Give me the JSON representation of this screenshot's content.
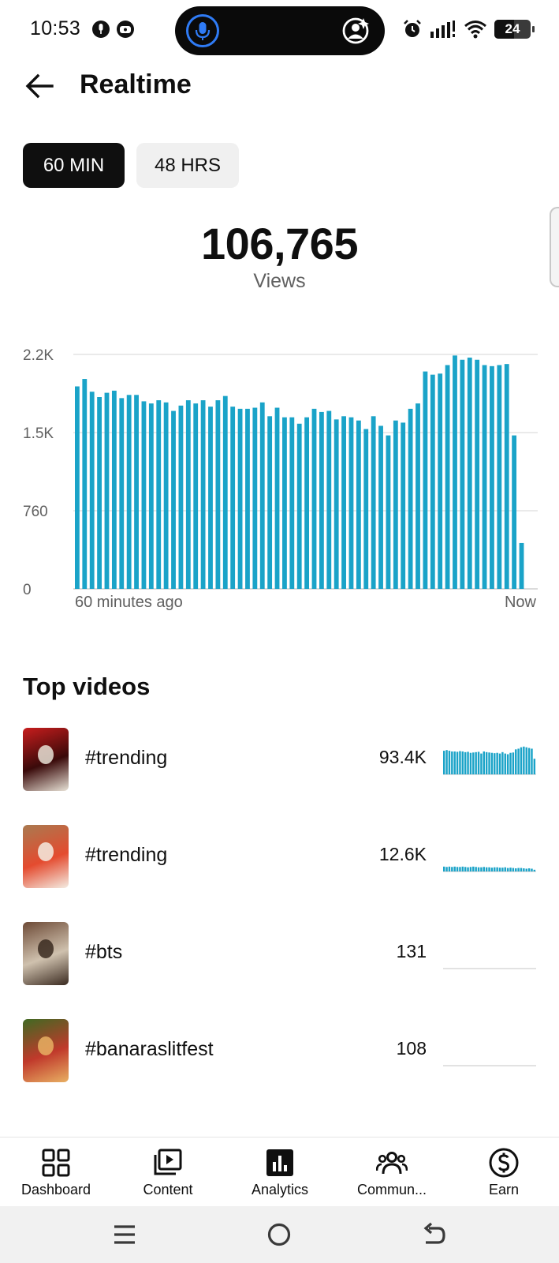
{
  "status_bar": {
    "time": "10:53",
    "battery": "24",
    "icons": [
      "mic-icon",
      "profile-icon",
      "alarm-icon",
      "signal-icon",
      "wifi-icon",
      "battery-icon"
    ]
  },
  "header": {
    "title": "Realtime",
    "back_icon": "back-arrow-icon"
  },
  "range_chips": [
    {
      "label": "60 MIN",
      "selected": true
    },
    {
      "label": "48 HRS",
      "selected": false
    }
  ],
  "summary": {
    "value": "106,765",
    "label": "Views"
  },
  "chart_data": {
    "type": "bar",
    "color": "#1aa3c8",
    "y_ticks": [
      "2.2K",
      "1.5K",
      "760",
      "0"
    ],
    "ylim": [
      0,
      2200
    ],
    "x_start_label": "60 minutes ago",
    "x_end_label": "Now",
    "values": [
      1900,
      1970,
      1850,
      1800,
      1840,
      1860,
      1790,
      1820,
      1820,
      1760,
      1740,
      1770,
      1750,
      1670,
      1720,
      1770,
      1740,
      1770,
      1710,
      1770,
      1810,
      1710,
      1690,
      1690,
      1700,
      1750,
      1620,
      1700,
      1610,
      1610,
      1550,
      1610,
      1690,
      1660,
      1670,
      1590,
      1620,
      1610,
      1580,
      1500,
      1620,
      1530,
      1440,
      1580,
      1560,
      1690,
      1740,
      2040,
      2010,
      2020,
      2100,
      2190,
      2150,
      2170,
      2150,
      2100,
      2090,
      2100,
      2110,
      1440,
      430
    ]
  },
  "top_videos": {
    "title": "Top videos",
    "items": [
      {
        "title": "#trending",
        "views": "93.4K",
        "thumb_colors": [
          "#c81d1d",
          "#3a0a0a",
          "#e8e2d6"
        ],
        "spark": [
          0.68,
          0.7,
          0.68,
          0.66,
          0.66,
          0.65,
          0.67,
          0.66,
          0.64,
          0.65,
          0.62,
          0.63,
          0.64,
          0.65,
          0.6,
          0.66,
          0.64,
          0.63,
          0.62,
          0.61,
          0.62,
          0.6,
          0.64,
          0.6,
          0.58,
          0.62,
          0.63,
          0.72,
          0.74,
          0.78,
          0.8,
          0.78,
          0.76,
          0.74,
          0.45
        ]
      },
      {
        "title": "#trending",
        "views": "12.6K",
        "thumb_colors": [
          "#a97a50",
          "#e44b2f",
          "#f4ece2"
        ],
        "spark": [
          0.14,
          0.13,
          0.14,
          0.13,
          0.14,
          0.13,
          0.13,
          0.14,
          0.13,
          0.12,
          0.13,
          0.14,
          0.13,
          0.12,
          0.12,
          0.13,
          0.12,
          0.12,
          0.11,
          0.12,
          0.12,
          0.11,
          0.11,
          0.12,
          0.1,
          0.11,
          0.1,
          0.09,
          0.1,
          0.1,
          0.09,
          0.08,
          0.09,
          0.08,
          0.05
        ]
      },
      {
        "title": "#bts",
        "views": "131",
        "thumb_colors": [
          "#6d4a36",
          "#cfc1ae",
          "#3a2a20"
        ],
        "spark": []
      },
      {
        "title": "#banaraslitfest",
        "views": "108",
        "thumb_colors": [
          "#3f6a22",
          "#c0392b",
          "#e8b063"
        ],
        "spark": []
      }
    ]
  },
  "bottom_nav": [
    {
      "label": "Dashboard",
      "icon": "dashboard-icon",
      "active": false
    },
    {
      "label": "Content",
      "icon": "content-icon",
      "active": false
    },
    {
      "label": "Analytics",
      "icon": "analytics-icon",
      "active": true
    },
    {
      "label": "Commun...",
      "icon": "community-icon",
      "active": false
    },
    {
      "label": "Earn",
      "icon": "earn-icon",
      "active": false
    }
  ],
  "system_nav": {
    "icons": [
      "menu-icon",
      "home-icon",
      "back-icon"
    ]
  }
}
